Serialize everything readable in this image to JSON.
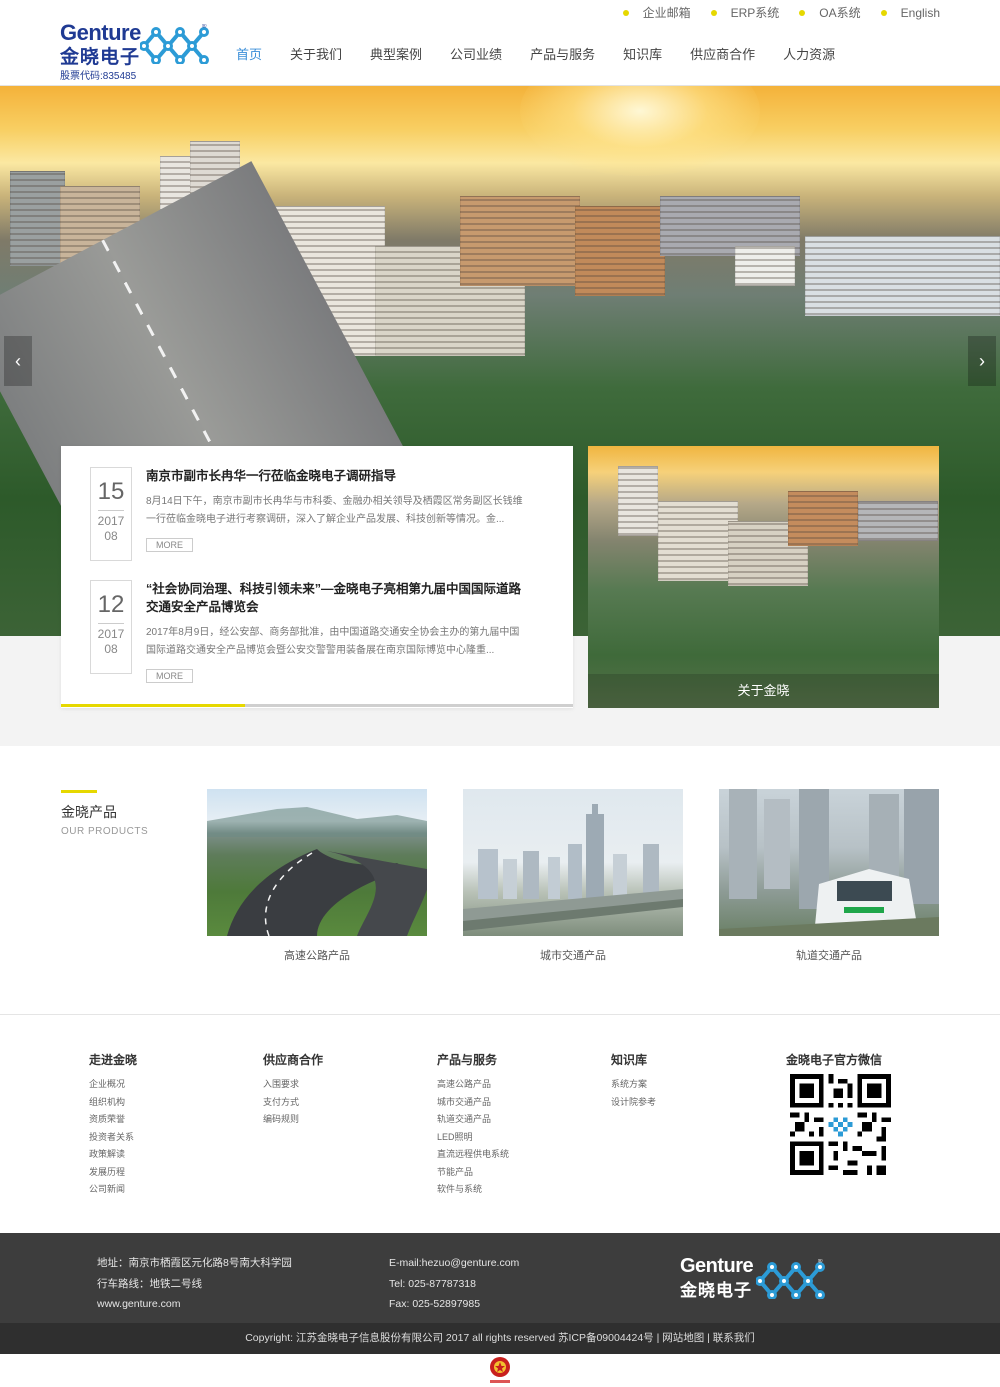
{
  "header": {
    "logo_en": "Genture",
    "logo_cn": "金晓电子",
    "stock_code": "股票代码:835485",
    "top_links": [
      {
        "label": "企业邮箱"
      },
      {
        "label": "ERP系统"
      },
      {
        "label": "OA系统"
      },
      {
        "label": "English"
      }
    ],
    "nav": [
      {
        "label": "首页"
      },
      {
        "label": "关于我们"
      },
      {
        "label": "典型案例"
      },
      {
        "label": "公司业绩"
      },
      {
        "label": "产品与服务"
      },
      {
        "label": "知识库"
      },
      {
        "label": "供应商合作"
      },
      {
        "label": "人力资源"
      }
    ]
  },
  "hero": {
    "prev_icon": "chevron-left-icon",
    "next_icon": "chevron-right-icon"
  },
  "news": {
    "items": [
      {
        "day": "15",
        "year": "2017",
        "month": "08",
        "title": "南京市副市长冉华一行莅临金晓电子调研指导",
        "summary": "8月14日下午，南京市副市长冉华与市科委、金融办相关领导及栖霞区常务副区长钱维一行莅临金晓电子进行考察调研，深入了解企业产品发展、科技创新等情况。金...",
        "more": "MORE"
      },
      {
        "day": "12",
        "year": "2017",
        "month": "08",
        "title": "“社会协同治理、科技引领未来”—金晓电子亮相第九届中国国际道路交通安全产品博览会",
        "summary": "2017年8月9日，经公安部、商务部批准，由中国道路交通安全协会主办的第九届中国国际道路交通安全产品博览会暨公安交警警用装备展在南京国际博览中心隆重...",
        "more": "MORE"
      }
    ],
    "progress": 0.36
  },
  "about": {
    "label": "关于金晓"
  },
  "products": {
    "title_cn": "金晓产品",
    "title_en": "OUR PRODUCTS",
    "items": [
      {
        "label": "高速公路产品"
      },
      {
        "label": "城市交通产品"
      },
      {
        "label": "轨道交通产品"
      }
    ]
  },
  "footer_links": {
    "columns": [
      {
        "title": "走进金晓",
        "items": [
          "企业概况",
          "组织机构",
          "资质荣誉",
          "投资者关系",
          "政策解读",
          "发展历程",
          "公司新闻"
        ]
      },
      {
        "title": "供应商合作",
        "items": [
          "入围要求",
          "支付方式",
          "编码规则"
        ]
      },
      {
        "title": "产品与服务",
        "items": [
          "高速公路产品",
          "城市交通产品",
          "轨道交通产品",
          "LED照明",
          "直流远程供电系统",
          "节能产品",
          "软件与系统"
        ]
      },
      {
        "title": "知识库",
        "items": [
          "系统方案",
          "设计院参考"
        ]
      },
      {
        "title": "金晓电子官方微信",
        "items": []
      }
    ]
  },
  "footer_dark": {
    "address": "地址：南京市栖霞区元化路8号南大科学园",
    "route": "行车路线：地铁二号线",
    "website": "www.genture.com",
    "email": "E-mail:hezuo@genture.com",
    "tel": "Tel: 025-87787318",
    "fax": "Fax: 025-52897985",
    "logo_en": "Genture",
    "logo_cn": "金晓电子"
  },
  "copyright": {
    "text": "Copyright: 江苏金晓电子信息股份有限公司 2017 all rights reserved 苏ICP备09004424号",
    "sitemap": "网站地图",
    "contact": "联系我们"
  },
  "colors": {
    "accent": "#e6d800",
    "brand": "#1f3a93",
    "nav_active": "#3a8ed8",
    "footer_dark": "#3d3d3d"
  }
}
